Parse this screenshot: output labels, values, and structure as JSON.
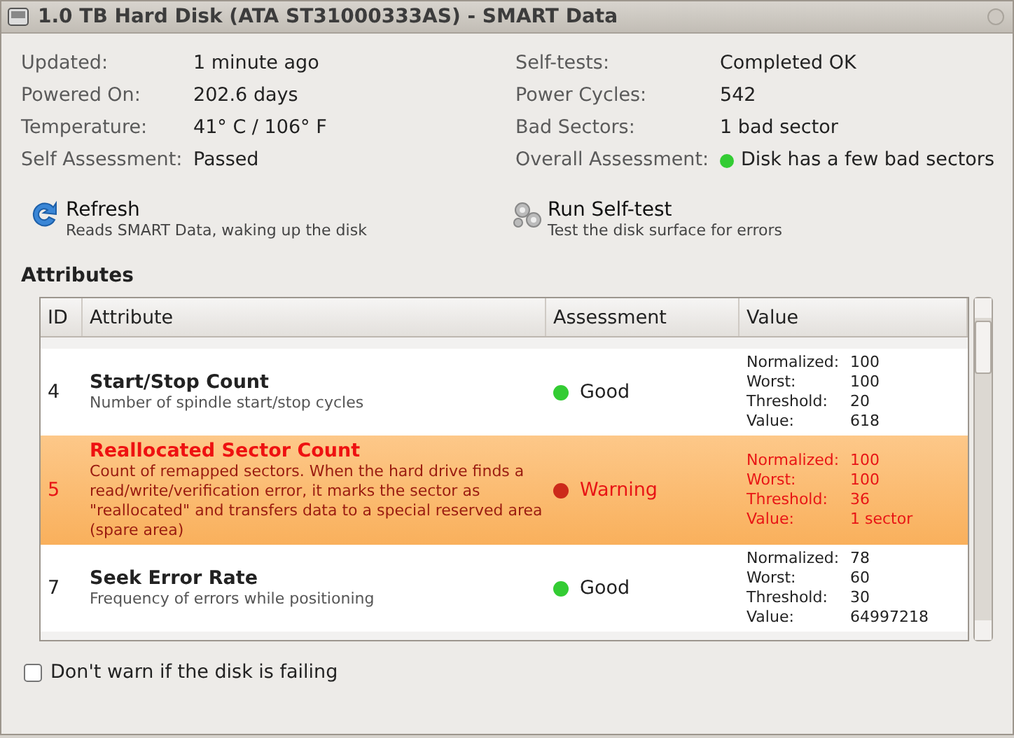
{
  "window": {
    "title": "1.0 TB Hard Disk (ATA ST31000333AS) - SMART Data"
  },
  "info_left": [
    {
      "label": "Updated:",
      "value": "1 minute ago"
    },
    {
      "label": "Powered On:",
      "value": "202.6 days"
    },
    {
      "label": "Temperature:",
      "value": "41° C / 106° F"
    },
    {
      "label": "Self Assessment:",
      "value": "Passed"
    }
  ],
  "info_right": [
    {
      "label": "Self-tests:",
      "value": "Completed OK"
    },
    {
      "label": "Power Cycles:",
      "value": "542"
    },
    {
      "label": "Bad Sectors:",
      "value": "1 bad sector"
    },
    {
      "label": "Overall Assessment:",
      "value": "Disk has a few bad sectors",
      "color": "#33cc33"
    }
  ],
  "actions": [
    {
      "kind": "refresh",
      "label": "Refresh",
      "description": "Reads SMART Data, waking up the disk"
    },
    {
      "kind": "selftest",
      "label": "Run Self-test",
      "description": "Test the disk surface for errors"
    }
  ],
  "attributes_heading": "Attributes",
  "table": {
    "columns": [
      "ID",
      "Attribute",
      "Assessment",
      "Value"
    ],
    "rows": [
      {
        "id": "4",
        "name": "Start/Stop Count",
        "description": "Number of spindle start/stop cycles",
        "assessment": "Good",
        "kind": "good",
        "color": "#33cc33",
        "values": [
          {
            "label": "Normalized:",
            "value": "100"
          },
          {
            "label": "Worst:",
            "value": "100"
          },
          {
            "label": "Threshold:",
            "value": "20"
          },
          {
            "label": "Value:",
            "value": "618"
          }
        ]
      },
      {
        "id": "5",
        "name": "Reallocated Sector Count",
        "description": "Count of remapped sectors. When the hard drive finds a read/write/verification error, it marks the sector as \"reallocated\" and transfers data to a special reserved area (spare area)",
        "assessment": "Warning",
        "kind": "warning",
        "color": "#cc2a1a",
        "values": [
          {
            "label": "Normalized:",
            "value": "100"
          },
          {
            "label": "Worst:",
            "value": "100"
          },
          {
            "label": "Threshold:",
            "value": "36"
          },
          {
            "label": "Value:",
            "value": "1 sector"
          }
        ]
      },
      {
        "id": "7",
        "name": "Seek Error Rate",
        "description": "Frequency of errors while positioning",
        "assessment": "Good",
        "kind": "good",
        "color": "#33cc33",
        "values": [
          {
            "label": "Normalized:",
            "value": "78"
          },
          {
            "label": "Worst:",
            "value": "60"
          },
          {
            "label": "Threshold:",
            "value": "30"
          },
          {
            "label": "Value:",
            "value": "64997218"
          }
        ]
      }
    ]
  },
  "dont_warn": {
    "label": "Don't warn if the disk is failing",
    "checked": false
  }
}
